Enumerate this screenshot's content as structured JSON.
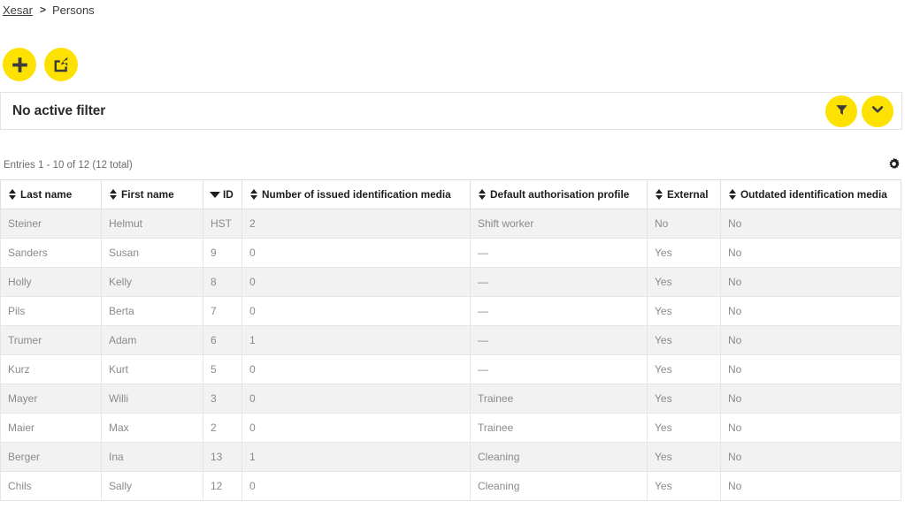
{
  "breadcrumb": {
    "root_label": "Xesar",
    "separator": ">",
    "current_label": "Persons"
  },
  "toolbar": {
    "add_label": "",
    "add_icon": "plus-icon",
    "export_label": "",
    "export_icon": "export-share-icon",
    "accent_color": "#fde100"
  },
  "filter_panel": {
    "status_text": "No active filter",
    "filter_icon": "funnel-icon",
    "expand_icon": "chevron-down-icon"
  },
  "entries": {
    "summary_text": "Entries 1 - 10 of 12 (12 total)",
    "settings_icon": "gear-icon"
  },
  "table": {
    "columns": [
      {
        "label": "Last name",
        "sort": "none",
        "key": "last_name"
      },
      {
        "label": "First name",
        "sort": "none",
        "key": "first_name"
      },
      {
        "label": "ID",
        "sort": "desc",
        "key": "id"
      },
      {
        "label": "Number of issued identification media",
        "sort": "none",
        "key": "issued_media"
      },
      {
        "label": "Default authorisation profile",
        "sort": "none",
        "key": "profile"
      },
      {
        "label": "External",
        "sort": "none",
        "key": "external"
      },
      {
        "label": "Outdated identification media",
        "sort": "none",
        "key": "outdated"
      }
    ],
    "rows": [
      {
        "last_name": "Steiner",
        "first_name": "Helmut",
        "id": "HST",
        "issued_media": "2",
        "profile": "Shift worker",
        "external": "No",
        "outdated": "No"
      },
      {
        "last_name": "Sanders",
        "first_name": "Susan",
        "id": "9",
        "issued_media": "0",
        "profile": "—",
        "external": "Yes",
        "outdated": "No"
      },
      {
        "last_name": "Holly",
        "first_name": "Kelly",
        "id": "8",
        "issued_media": "0",
        "profile": "—",
        "external": "Yes",
        "outdated": "No"
      },
      {
        "last_name": "Pils",
        "first_name": "Berta",
        "id": "7",
        "issued_media": "0",
        "profile": "—",
        "external": "Yes",
        "outdated": "No"
      },
      {
        "last_name": "Trumer",
        "first_name": "Adam",
        "id": "6",
        "issued_media": "1",
        "profile": "—",
        "external": "Yes",
        "outdated": "No"
      },
      {
        "last_name": "Kurz",
        "first_name": "Kurt",
        "id": "5",
        "issued_media": "0",
        "profile": "—",
        "external": "Yes",
        "outdated": "No"
      },
      {
        "last_name": "Mayer",
        "first_name": "Willi",
        "id": "3",
        "issued_media": "0",
        "profile": "Trainee",
        "external": "Yes",
        "outdated": "No"
      },
      {
        "last_name": "Maier",
        "first_name": "Max",
        "id": "2",
        "issued_media": "0",
        "profile": "Trainee",
        "external": "Yes",
        "outdated": "No"
      },
      {
        "last_name": "Berger",
        "first_name": "Ina",
        "id": "13",
        "issued_media": "1",
        "profile": "Cleaning",
        "external": "Yes",
        "outdated": "No"
      },
      {
        "last_name": "Chils",
        "first_name": "Sally",
        "id": "12",
        "issued_media": "0",
        "profile": "Cleaning",
        "external": "Yes",
        "outdated": "No"
      }
    ]
  }
}
